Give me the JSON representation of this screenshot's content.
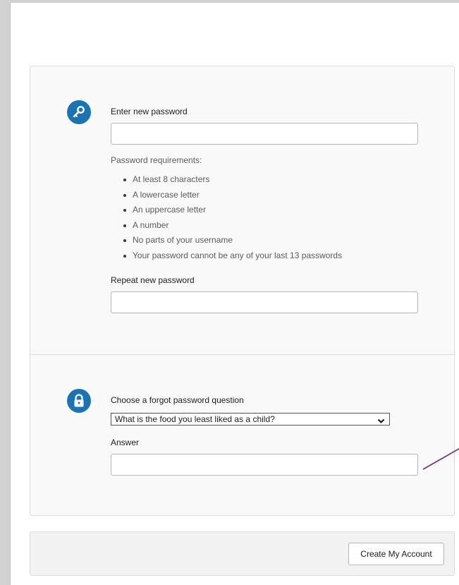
{
  "password_section": {
    "new_password_label": "Enter new password",
    "new_password_value": "",
    "requirements_title": "Password requirements:",
    "requirements": [
      "At least 8 characters",
      "A lowercase letter",
      "An uppercase letter",
      "A number",
      "No parts of your username",
      "Your password cannot be any of your last 13 passwords"
    ],
    "repeat_password_label": "Repeat new password",
    "repeat_password_value": "",
    "icon": "key-icon"
  },
  "security_question_section": {
    "question_label": "Choose a forgot password question",
    "selected_question": "What is the food you least liked as a child?",
    "answer_label": "Answer",
    "answer_value": "",
    "icon": "lock-icon"
  },
  "footer": {
    "create_account_label": "Create My Account"
  },
  "colors": {
    "accent": "#1a74b4",
    "annotation_line": "#6b2c7a"
  }
}
